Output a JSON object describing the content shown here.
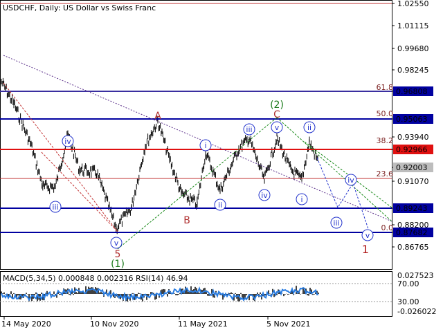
{
  "header": {
    "title": "USDCHF, Daily:  US Dollar vs Swiss Franc"
  },
  "price_axis": {
    "ticks": [
      "1.02550",
      "1.01115",
      "0.99680",
      "0.98245",
      "0.96808",
      "0.95063",
      "0.93940",
      "0.92966",
      "0.92003",
      "0.91070",
      "0.89243",
      "0.88200",
      "0.87682",
      "0.86765"
    ],
    "highlighted": [
      {
        "label": "0.96808",
        "bg": "#0000a0",
        "fg": "#ffffff"
      },
      {
        "label": "0.95063",
        "bg": "#0000a0",
        "fg": "#ffffff"
      },
      {
        "label": "0.92966",
        "bg": "#e01010",
        "fg": "#ffffff"
      },
      {
        "label": "0.92003",
        "bg": "#bdbdbd",
        "fg": "#ffffff"
      },
      {
        "label": "0.89243",
        "bg": "#0000a0",
        "fg": "#ffffff"
      },
      {
        "label": "0.87682",
        "bg": "#0000a0",
        "fg": "#ffffff"
      }
    ]
  },
  "fib_levels": [
    "61.8",
    "50.0",
    "38.2",
    "23.6",
    "0.0"
  ],
  "wave_labels": {
    "A": "A",
    "B": "B",
    "C": "C",
    "five_red": "5",
    "one_green": "(1)",
    "two_green": "(2)",
    "one_red": "1",
    "iii_1": "iii",
    "iv_1": "iv",
    "v_1": "v",
    "i_2": "i",
    "ii_2": "ii",
    "iii_2": "iii",
    "iv_2": "iv",
    "v_2": "v",
    "i_3": "i",
    "ii_3": "ii",
    "iii_f": "iii",
    "iv_f": "iv",
    "v_f": "v"
  },
  "indicator": {
    "label": "MACD(5,34,5) 0.000848 0.002316 RSI(14) 46.94",
    "ticks": [
      "0.027523",
      "70.00",
      "30.00",
      "-0.026022"
    ]
  },
  "time_axis": {
    "labels": [
      "14 May 2020",
      "10 Nov 2020",
      "11 May 2021",
      "5 Nov 2021"
    ]
  },
  "colors": {
    "navy": "#0000a0",
    "red": "#e01010",
    "fib": "#7a1f1f",
    "wave_blue": "#2233cc",
    "wave_green": "#1a7a1a"
  }
}
